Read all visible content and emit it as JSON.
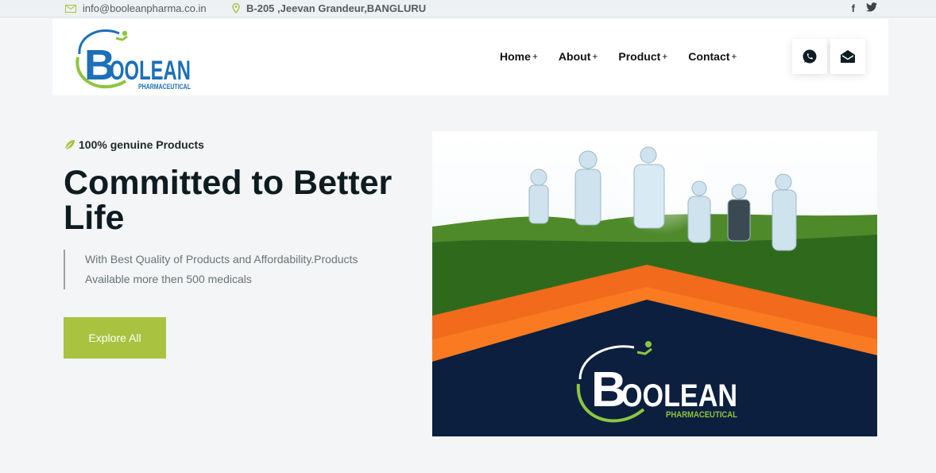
{
  "topbar": {
    "email": "info@booleanpharma.co.in",
    "address": "B-205 ,Jeevan Grandeur,BANGLURU",
    "social": [
      {
        "icon": "facebook-icon",
        "label": "f"
      },
      {
        "icon": "twitter-icon",
        "label": "🐦"
      }
    ]
  },
  "brand": {
    "name": "OOLEAN",
    "initial": "B",
    "sub": "PHARMACEUTICAL",
    "colors": {
      "blue": "#1d6fb8",
      "green": "#8cc63f",
      "navy": "#0c1f3f",
      "orange": "#f26a1b"
    }
  },
  "nav": {
    "items": [
      {
        "label": "Home",
        "plus": "+"
      },
      {
        "label": "About",
        "plus": "+"
      },
      {
        "label": "Product",
        "plus": "+"
      },
      {
        "label": "Contact",
        "plus": "+"
      }
    ]
  },
  "hero": {
    "badge": "100% genuine Products",
    "headline": "Committed to Better Life",
    "description": "With Best Quality of Products and Affordability.Products Available more then 500 medicals",
    "cta": "Explore All",
    "accent": "#a9c23f"
  }
}
